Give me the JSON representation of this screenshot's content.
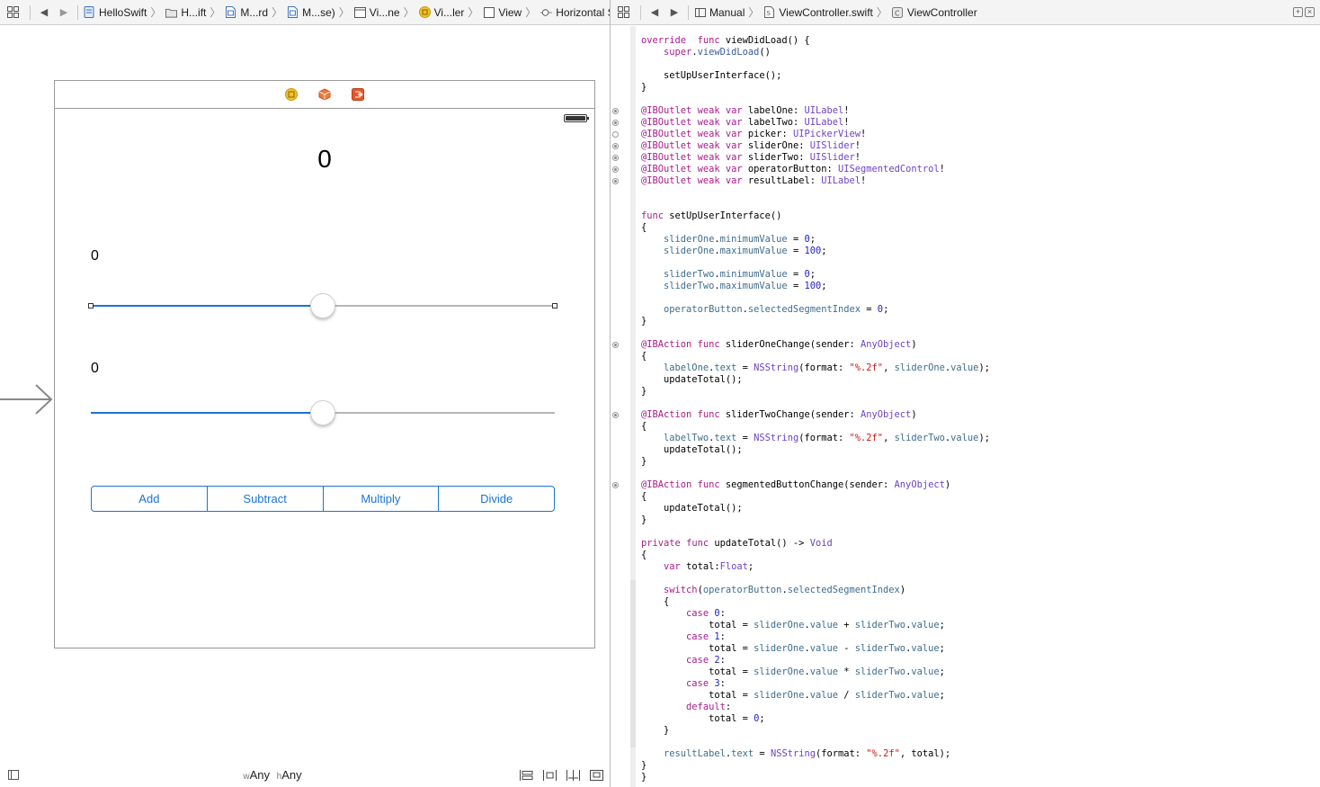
{
  "left_jumpbar": {
    "crumbs": [
      {
        "label": "HelloSwift",
        "icon": "project-icon"
      },
      {
        "label": "H...ift",
        "icon": "folder-icon"
      },
      {
        "label": "M...rd",
        "icon": "storyboard-icon"
      },
      {
        "label": "M...se)",
        "icon": "storyboard-icon"
      },
      {
        "label": "Vi...ne",
        "icon": "scene-icon"
      },
      {
        "label": "Vi...ler",
        "icon": "view-controller-icon"
      },
      {
        "label": "View",
        "icon": "view-icon"
      },
      {
        "label": "Horizontal Slider",
        "icon": "slider-icon"
      }
    ]
  },
  "right_jumpbar": {
    "mode": "Manual",
    "file": "ViewController.swift",
    "symbol": "ViewController"
  },
  "scene": {
    "result_label": "0",
    "slider_one": {
      "label": "0",
      "value": 0.5
    },
    "slider_two": {
      "label": "0",
      "value": 0.5
    },
    "segments": [
      "Add",
      "Subtract",
      "Multiply",
      "Divide"
    ]
  },
  "size_class": {
    "w_prefix": "w",
    "w_value": "Any",
    "h_prefix": "h",
    "h_value": "Any"
  },
  "code": [
    [
      [
        "kw",
        "override"
      ],
      [
        "",
        "  "
      ],
      [
        "kw",
        "func"
      ],
      [
        "",
        " viewDidLoad() {"
      ]
    ],
    [
      [
        "",
        "    "
      ],
      [
        "kw",
        "super"
      ],
      [
        ".",
        ""
      ],
      [
        "mc",
        "viewDidLoad"
      ],
      [
        "",
        "()"
      ]
    ],
    [],
    [
      [
        "",
        "    setUpUserInterface();"
      ]
    ],
    [
      [
        "",
        "}"
      ]
    ],
    [],
    [
      [
        "at",
        "@IBOutlet"
      ],
      [
        "",
        " "
      ],
      [
        "kw",
        "weak"
      ],
      [
        "",
        " "
      ],
      [
        "kw",
        "var"
      ],
      [
        "",
        " labelOne: "
      ],
      [
        "ty",
        "UILabel"
      ],
      [
        "",
        "!"
      ]
    ],
    [
      [
        "at",
        "@IBOutlet"
      ],
      [
        "",
        " "
      ],
      [
        "kw",
        "weak"
      ],
      [
        "",
        " "
      ],
      [
        "kw",
        "var"
      ],
      [
        "",
        " labelTwo: "
      ],
      [
        "ty",
        "UILabel"
      ],
      [
        "",
        "!"
      ]
    ],
    [
      [
        "at",
        "@IBOutlet"
      ],
      [
        "",
        " "
      ],
      [
        "kw",
        "weak"
      ],
      [
        "",
        " "
      ],
      [
        "kw",
        "var"
      ],
      [
        "",
        " picker: "
      ],
      [
        "ty",
        "UIPickerView"
      ],
      [
        "",
        "!"
      ]
    ],
    [
      [
        "at",
        "@IBOutlet"
      ],
      [
        "",
        " "
      ],
      [
        "kw",
        "weak"
      ],
      [
        "",
        " "
      ],
      [
        "kw",
        "var"
      ],
      [
        "",
        " sliderOne: "
      ],
      [
        "ty",
        "UISlider"
      ],
      [
        "",
        "!"
      ]
    ],
    [
      [
        "at",
        "@IBOutlet"
      ],
      [
        "",
        " "
      ],
      [
        "kw",
        "weak"
      ],
      [
        "",
        " "
      ],
      [
        "kw",
        "var"
      ],
      [
        "",
        " sliderTwo: "
      ],
      [
        "ty",
        "UISlider"
      ],
      [
        "",
        "!"
      ]
    ],
    [
      [
        "at",
        "@IBOutlet"
      ],
      [
        "",
        " "
      ],
      [
        "kw",
        "weak"
      ],
      [
        "",
        " "
      ],
      [
        "kw",
        "var"
      ],
      [
        "",
        " operatorButton: "
      ],
      [
        "ty",
        "UISegmentedControl"
      ],
      [
        "",
        "!"
      ]
    ],
    [
      [
        "at",
        "@IBOutlet"
      ],
      [
        "",
        " "
      ],
      [
        "kw",
        "weak"
      ],
      [
        "",
        " "
      ],
      [
        "kw",
        "var"
      ],
      [
        "",
        " resultLabel: "
      ],
      [
        "ty",
        "UILabel"
      ],
      [
        "",
        "!"
      ]
    ],
    [],
    [],
    [
      [
        "kw",
        "func"
      ],
      [
        "",
        " setUpUserInterface()"
      ]
    ],
    [
      [
        "",
        "{"
      ]
    ],
    [
      [
        "",
        "    "
      ],
      [
        "pr",
        "sliderOne"
      ],
      [
        "",
        "."
      ],
      [
        "pr",
        "minimumValue"
      ],
      [
        "",
        " = "
      ],
      [
        "num",
        "0"
      ],
      [
        "",
        ";"
      ]
    ],
    [
      [
        "",
        "    "
      ],
      [
        "pr",
        "sliderOne"
      ],
      [
        "",
        "."
      ],
      [
        "pr",
        "maximumValue"
      ],
      [
        "",
        " = "
      ],
      [
        "num",
        "100"
      ],
      [
        "",
        ";"
      ]
    ],
    [],
    [
      [
        "",
        "    "
      ],
      [
        "pr",
        "sliderTwo"
      ],
      [
        "",
        "."
      ],
      [
        "pr",
        "minimumValue"
      ],
      [
        "",
        " = "
      ],
      [
        "num",
        "0"
      ],
      [
        "",
        ";"
      ]
    ],
    [
      [
        "",
        "    "
      ],
      [
        "pr",
        "sliderTwo"
      ],
      [
        "",
        "."
      ],
      [
        "pr",
        "maximumValue"
      ],
      [
        "",
        " = "
      ],
      [
        "num",
        "100"
      ],
      [
        "",
        ";"
      ]
    ],
    [],
    [
      [
        "",
        "    "
      ],
      [
        "pr",
        "operatorButton"
      ],
      [
        "",
        "."
      ],
      [
        "pr",
        "selectedSegmentIndex"
      ],
      [
        "",
        " = "
      ],
      [
        "num",
        "0"
      ],
      [
        "",
        ";"
      ]
    ],
    [
      [
        "",
        "}"
      ]
    ],
    [],
    [
      [
        "at",
        "@IBAction"
      ],
      [
        "",
        " "
      ],
      [
        "kw",
        "func"
      ],
      [
        "",
        " sliderOneChange(sender: "
      ],
      [
        "ty",
        "AnyObject"
      ],
      [
        "",
        ")"
      ]
    ],
    [
      [
        "",
        "{"
      ]
    ],
    [
      [
        "",
        "    "
      ],
      [
        "pr",
        "labelOne"
      ],
      [
        "",
        "."
      ],
      [
        "pr",
        "text"
      ],
      [
        "",
        " = "
      ],
      [
        "ty",
        "NSString"
      ],
      [
        "",
        "(format: "
      ],
      [
        "str",
        "\"%.2f\""
      ],
      [
        "",
        ", "
      ],
      [
        "pr",
        "sliderOne"
      ],
      [
        "",
        "."
      ],
      [
        "pr",
        "value"
      ],
      [
        "",
        ");"
      ]
    ],
    [
      [
        "",
        "    updateTotal();"
      ]
    ],
    [
      [
        "",
        "}"
      ]
    ],
    [],
    [
      [
        "at",
        "@IBAction"
      ],
      [
        "",
        " "
      ],
      [
        "kw",
        "func"
      ],
      [
        "",
        " sliderTwoChange(sender: "
      ],
      [
        "ty",
        "AnyObject"
      ],
      [
        "",
        ")"
      ]
    ],
    [
      [
        "",
        "{"
      ]
    ],
    [
      [
        "",
        "    "
      ],
      [
        "pr",
        "labelTwo"
      ],
      [
        "",
        "."
      ],
      [
        "pr",
        "text"
      ],
      [
        "",
        " = "
      ],
      [
        "ty",
        "NSString"
      ],
      [
        "",
        "(format: "
      ],
      [
        "str",
        "\"%.2f\""
      ],
      [
        "",
        ", "
      ],
      [
        "pr",
        "sliderTwo"
      ],
      [
        "",
        "."
      ],
      [
        "pr",
        "value"
      ],
      [
        "",
        ");"
      ]
    ],
    [
      [
        "",
        "    updateTotal();"
      ]
    ],
    [
      [
        "",
        "}"
      ]
    ],
    [],
    [
      [
        "at",
        "@IBAction"
      ],
      [
        "",
        " "
      ],
      [
        "kw",
        "func"
      ],
      [
        "",
        " segmentedButtonChange(sender: "
      ],
      [
        "ty",
        "AnyObject"
      ],
      [
        "",
        ")"
      ]
    ],
    [
      [
        "",
        "{"
      ]
    ],
    [
      [
        "",
        "    updateTotal();"
      ]
    ],
    [
      [
        "",
        "}"
      ]
    ],
    [],
    [
      [
        "kw",
        "private"
      ],
      [
        "",
        " "
      ],
      [
        "kw",
        "func"
      ],
      [
        "",
        " updateTotal() -> "
      ],
      [
        "ty",
        "Void"
      ]
    ],
    [
      [
        "",
        "{"
      ]
    ],
    [
      [
        "",
        "    "
      ],
      [
        "kw",
        "var"
      ],
      [
        "",
        " total:"
      ],
      [
        "ty",
        "Float"
      ],
      [
        "",
        ";"
      ]
    ],
    [],
    [
      [
        "",
        "    "
      ],
      [
        "kw",
        "switch"
      ],
      [
        "",
        "("
      ],
      [
        "pr",
        "operatorButton"
      ],
      [
        "",
        "."
      ],
      [
        "pr",
        "selectedSegmentIndex"
      ],
      [
        "",
        ")"
      ]
    ],
    [
      [
        "",
        "    {"
      ]
    ],
    [
      [
        "",
        "        "
      ],
      [
        "kw",
        "case"
      ],
      [
        "",
        " "
      ],
      [
        "num",
        "0"
      ],
      [
        "",
        ":"
      ]
    ],
    [
      [
        "",
        "            total = "
      ],
      [
        "pr",
        "sliderOne"
      ],
      [
        "",
        "."
      ],
      [
        "pr",
        "value"
      ],
      [
        "",
        " + "
      ],
      [
        "pr",
        "sliderTwo"
      ],
      [
        "",
        "."
      ],
      [
        "pr",
        "value"
      ],
      [
        "",
        ";"
      ]
    ],
    [
      [
        "",
        "        "
      ],
      [
        "kw",
        "case"
      ],
      [
        "",
        " "
      ],
      [
        "num",
        "1"
      ],
      [
        "",
        ":"
      ]
    ],
    [
      [
        "",
        "            total = "
      ],
      [
        "pr",
        "sliderOne"
      ],
      [
        "",
        "."
      ],
      [
        "pr",
        "value"
      ],
      [
        "",
        " - "
      ],
      [
        "pr",
        "sliderTwo"
      ],
      [
        "",
        "."
      ],
      [
        "pr",
        "value"
      ],
      [
        "",
        ";"
      ]
    ],
    [
      [
        "",
        "        "
      ],
      [
        "kw",
        "case"
      ],
      [
        "",
        " "
      ],
      [
        "num",
        "2"
      ],
      [
        "",
        ":"
      ]
    ],
    [
      [
        "",
        "            total = "
      ],
      [
        "pr",
        "sliderOne"
      ],
      [
        "",
        "."
      ],
      [
        "pr",
        "value"
      ],
      [
        "",
        " * "
      ],
      [
        "pr",
        "sliderTwo"
      ],
      [
        "",
        "."
      ],
      [
        "pr",
        "value"
      ],
      [
        "",
        ";"
      ]
    ],
    [
      [
        "",
        "        "
      ],
      [
        "kw",
        "case"
      ],
      [
        "",
        " "
      ],
      [
        "num",
        "3"
      ],
      [
        "",
        ":"
      ]
    ],
    [
      [
        "",
        "            total = "
      ],
      [
        "pr",
        "sliderOne"
      ],
      [
        "",
        "."
      ],
      [
        "pr",
        "value"
      ],
      [
        "",
        " / "
      ],
      [
        "pr",
        "sliderTwo"
      ],
      [
        "",
        "."
      ],
      [
        "pr",
        "value"
      ],
      [
        "",
        ";"
      ]
    ],
    [
      [
        "",
        "        "
      ],
      [
        "kw",
        "default"
      ],
      [
        "",
        ":"
      ]
    ],
    [
      [
        "",
        "            total = "
      ],
      [
        "num",
        "0"
      ],
      [
        "",
        ";"
      ]
    ],
    [
      [
        "",
        "    }"
      ]
    ],
    [],
    [
      [
        "",
        "    "
      ],
      [
        "pr",
        "resultLabel"
      ],
      [
        "",
        "."
      ],
      [
        "pr",
        "text"
      ],
      [
        "",
        " = "
      ],
      [
        "ty",
        "NSString"
      ],
      [
        "",
        "(format: "
      ],
      [
        "str",
        "\"%.2f\""
      ],
      [
        "",
        ", total);"
      ]
    ],
    [
      [
        "",
        "}"
      ]
    ],
    [
      [
        "",
        "}"
      ]
    ]
  ],
  "connections": [
    {
      "line": 6,
      "filled": true
    },
    {
      "line": 7,
      "filled": true
    },
    {
      "line": 8,
      "filled": false
    },
    {
      "line": 9,
      "filled": true
    },
    {
      "line": 10,
      "filled": true
    },
    {
      "line": 11,
      "filled": true
    },
    {
      "line": 12,
      "filled": true
    },
    {
      "line": 26,
      "filled": true
    },
    {
      "line": 32,
      "filled": true
    },
    {
      "line": 38,
      "filled": true
    }
  ]
}
